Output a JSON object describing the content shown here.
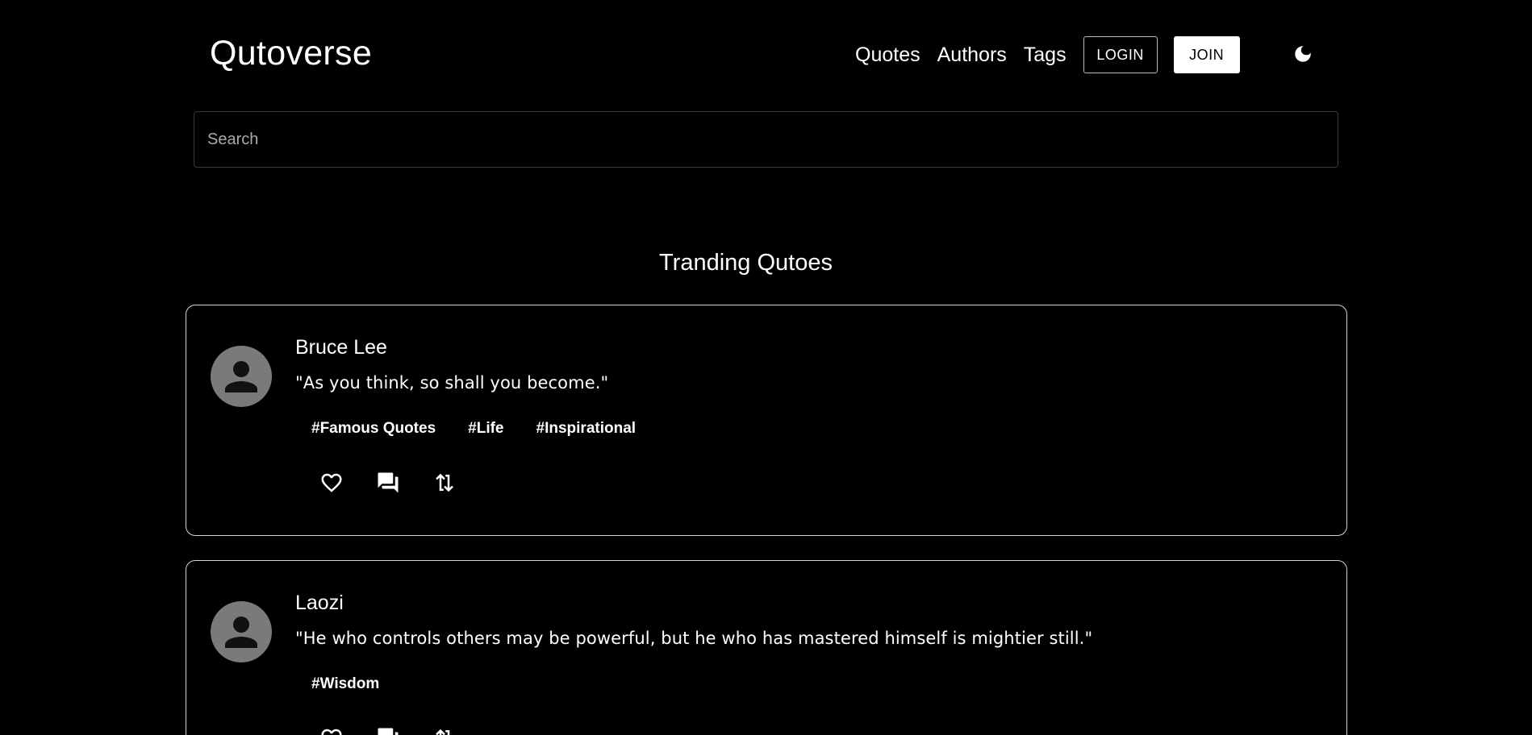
{
  "header": {
    "brand": "Qutoverse",
    "nav": [
      "Quotes",
      "Authors",
      "Tags"
    ],
    "login_label": "LOGIN",
    "join_label": "JOIN",
    "theme_icon": "moon-icon"
  },
  "search": {
    "placeholder": "Search"
  },
  "section": {
    "title": "Tranding Qutoes"
  },
  "quotes": [
    {
      "author": "Bruce Lee",
      "text": "\"As you think, so shall you become.\"",
      "tags": [
        "#Famous Quotes",
        "#Life",
        "#Inspirational"
      ],
      "actions": [
        "heart-icon",
        "comment-icon",
        "share-icon"
      ]
    },
    {
      "author": "Laozi",
      "text": "\"He who controls others may be powerful, but he who has mastered himself is mightier still.\"",
      "tags": [
        "#Wisdom"
      ],
      "actions": [
        "heart-icon",
        "comment-icon",
        "share-icon"
      ]
    }
  ],
  "colors": {
    "background": "#000000",
    "text": "#ffffff",
    "avatar": "#7a7a7a",
    "card_border": "#d6d6d6"
  }
}
